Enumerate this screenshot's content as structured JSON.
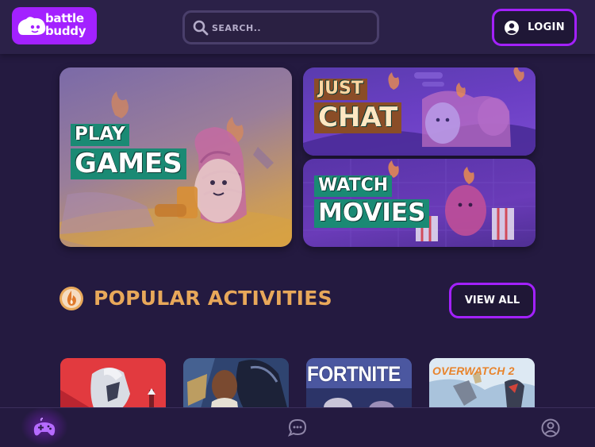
{
  "brand": {
    "line1": "battle",
    "line2": "buddy",
    "color": "#a321ff"
  },
  "search": {
    "placeholder": "SEARCH..",
    "value": ""
  },
  "header": {
    "login_label": "LOGIN",
    "login_icon": "user-circle-icon"
  },
  "hero": {
    "play": {
      "line1": "PLAY",
      "line2": "GAMES"
    },
    "chat": {
      "line1": "JUST",
      "line2": "CHAT"
    },
    "movies": {
      "line1": "WATCH",
      "line2": "MOVIES"
    }
  },
  "popular": {
    "title": "POPULAR ACTIVITIES",
    "icon": "flame-badge-icon",
    "view_all_label": "VIEW ALL",
    "accent": "#e8a85a",
    "games": [
      {
        "name": "valorant",
        "label": ""
      },
      {
        "name": "league-of-legends",
        "label": ""
      },
      {
        "name": "fortnite",
        "label": "FORTNITE"
      },
      {
        "name": "overwatch",
        "label": "OVERWATCH 2"
      }
    ]
  },
  "bottom_nav": {
    "items": [
      {
        "name": "games",
        "icon": "gamepad-icon",
        "active": true
      },
      {
        "name": "chat",
        "icon": "chat-bubble-icon",
        "active": false
      },
      {
        "name": "profile",
        "icon": "profile-icon",
        "active": false
      }
    ]
  }
}
